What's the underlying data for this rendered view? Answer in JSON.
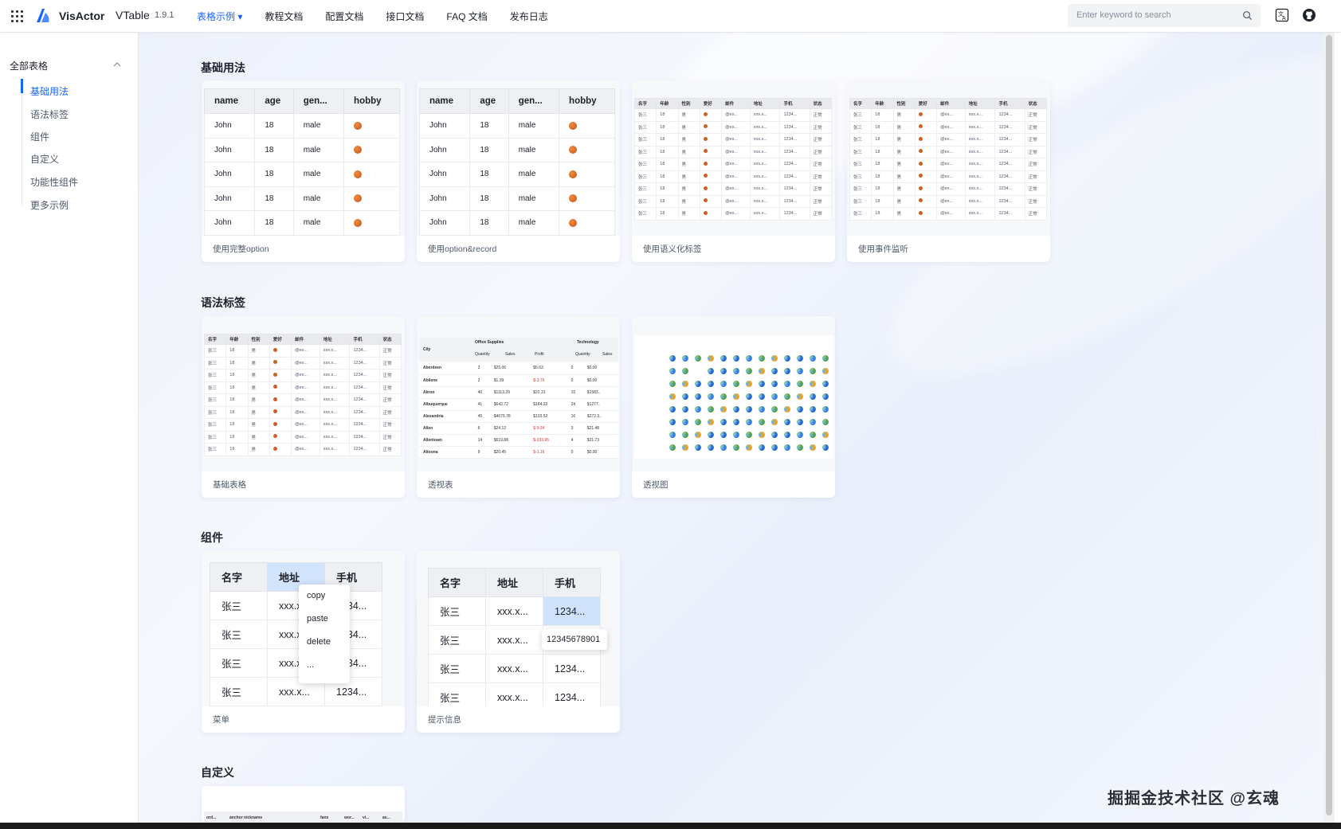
{
  "header": {
    "brand": "VisActor",
    "product": "VTable",
    "version": "1.9.1",
    "nav": [
      {
        "label": "表格示例",
        "active": true
      },
      {
        "label": "教程文档"
      },
      {
        "label": "配置文档"
      },
      {
        "label": "接口文档"
      },
      {
        "label": "FAQ 文档"
      },
      {
        "label": "发布日志"
      }
    ],
    "search_placeholder": "Enter keyword to search",
    "icons": [
      "apps-grid-icon",
      "visactor-logo",
      "chevron-down-icon",
      "search-icon",
      "translate-icon",
      "github-icon"
    ]
  },
  "sidebar": {
    "title": "全部表格",
    "items": [
      {
        "label": "基础用法",
        "active": true
      },
      {
        "label": "语法标签"
      },
      {
        "label": "组件"
      },
      {
        "label": "自定义"
      },
      {
        "label": "功能性组件"
      },
      {
        "label": "更多示例"
      }
    ]
  },
  "sections": [
    {
      "title": "基础用法",
      "cards": [
        "使用完整option",
        "使用option&record",
        "使用语义化标签",
        "使用事件监听"
      ]
    },
    {
      "title": "语法标签",
      "cards": [
        "基础表格",
        "透视表",
        "透视图"
      ]
    },
    {
      "title": "组件",
      "cards": [
        "菜单",
        "提示信息"
      ]
    },
    {
      "title": "自定义",
      "cards": []
    }
  ],
  "basic_table": {
    "headers": [
      "name",
      "age",
      "gen...",
      "hobby"
    ],
    "rows": [
      [
        "John",
        "18",
        "male"
      ],
      [
        "John",
        "18",
        "male"
      ],
      [
        "John",
        "18",
        "male"
      ],
      [
        "John",
        "18",
        "male"
      ],
      [
        "John",
        "18",
        "male"
      ]
    ]
  },
  "mini_table": {
    "headers": [
      "名字",
      "年龄",
      "性别",
      "爱好",
      "邮件",
      "地址",
      "手机",
      "状态"
    ],
    "row": [
      "张三",
      "18",
      "男",
      "",
      "@ex...",
      "xxx.x...",
      "1234...",
      "正常"
    ]
  },
  "pivot_table": {
    "group_headers": [
      "Office Supplies",
      "Technology"
    ],
    "sub_headers": [
      "City",
      "Quantity",
      "Sales",
      "Profit",
      "Quantity",
      "Sales"
    ],
    "rows": [
      [
        "Aberdeen",
        "3",
        "$25.06",
        "$6.63",
        "0",
        "$0.00"
      ],
      [
        "Abilene",
        "2",
        "$1.39",
        "$-3.76",
        "0",
        "$0.00"
      ],
      [
        "Akron",
        "40",
        "$1113.29",
        "$22.31",
        "15",
        "$1583.."
      ],
      [
        "Albuquerque",
        "41",
        "$642.72",
        "$184.32",
        "24",
        "$1277.."
      ],
      [
        "Alexandria",
        "45",
        "$4679.78",
        "$133.52",
        "16",
        "$272.3.."
      ],
      [
        "Allen",
        "6",
        "$24.12",
        "$-9.24",
        "3",
        "$21.48"
      ],
      [
        "Allentown",
        "14",
        "$619.88",
        "$-233.95",
        "4",
        "$21.73"
      ],
      [
        "Altoona",
        "9",
        "$20.45",
        "$-1.16",
        "0",
        "$0.00"
      ]
    ]
  },
  "menu_table": {
    "headers": [
      "名字",
      "地址",
      "手机"
    ],
    "rows": [
      [
        "张三",
        "xxx.x...",
        "1234..."
      ],
      [
        "张三",
        "xxx.x...",
        "1234..."
      ],
      [
        "张三",
        "xxx.x...",
        "1234..."
      ],
      [
        "张三",
        "xxx.x...",
        "1234..."
      ]
    ],
    "menu_items": [
      "copy",
      "paste",
      "delete",
      "..."
    ]
  },
  "tooltip_table": {
    "headers": [
      "名字",
      "地址",
      "手机"
    ],
    "rows": [
      [
        "张三",
        "xxx.x...",
        "1234..."
      ],
      [
        "张三",
        "xxx.x...",
        ""
      ],
      [
        "张三",
        "xxx.x...",
        "1234..."
      ],
      [
        "张三",
        "xxx.x...",
        "1234..."
      ]
    ],
    "tooltip": "12345678901"
  },
  "custom_preview": {
    "headers": [
      "ord...",
      "anchor nickname",
      "fans",
      "wor...",
      "vi...",
      "as..."
    ]
  },
  "watermark": "掘掘金技术社区 @玄魂"
}
